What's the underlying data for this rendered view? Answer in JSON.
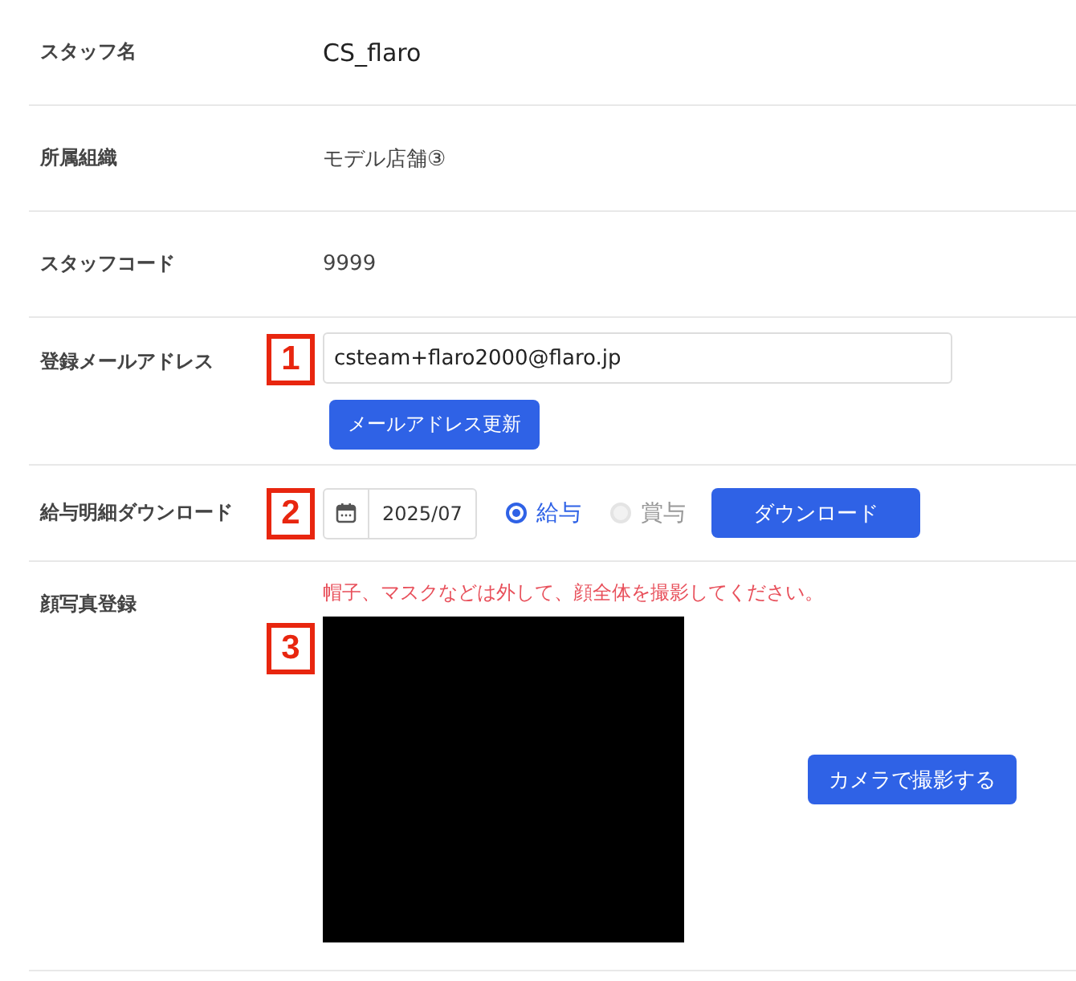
{
  "rows": [
    {
      "kind": "text",
      "label": "スタッフ名",
      "value": "CS_flaro",
      "large": true
    },
    {
      "kind": "text",
      "label": "所属組織",
      "value": "モデル店舗③",
      "large": false
    },
    {
      "kind": "text",
      "label": "スタッフコード",
      "value": "9999",
      "large": false
    },
    {
      "kind": "email",
      "label": "登録メールアドレス",
      "marker": "1",
      "email": "csteam+flaro2000@flaro.jp",
      "button": "メールアドレス更新"
    },
    {
      "kind": "payslip",
      "label": "給与明細ダウンロード",
      "marker": "2",
      "month": "2025/07",
      "options": [
        {
          "label": "給与",
          "selected": true,
          "disabled": false
        },
        {
          "label": "賞与",
          "selected": false,
          "disabled": true
        }
      ],
      "button": "ダウンロード"
    },
    {
      "kind": "photo",
      "label": "顔写真登録",
      "marker": "3",
      "notice": "帽子、マスクなどは外して、顔全体を撮影してください。",
      "button": "カメラで撮影する"
    }
  ]
}
